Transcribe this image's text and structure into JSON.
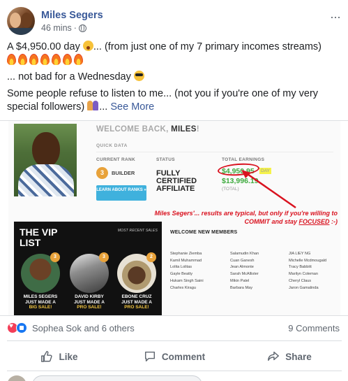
{
  "post": {
    "author": "Miles Segers",
    "time": "46 mins",
    "separator": "·",
    "more_icon": "···",
    "text_line1": "A $4,950.00 day",
    "text_line1_b": "... (from just one of my 7 primary incomes streams)",
    "text_line2": "... not bad for a Wednesday",
    "text_line3": "Some people refuse to listen to me... (not you if you're one of my very special followers)",
    "text_line3_b": "...",
    "see_more": "See More"
  },
  "image": {
    "welcome_prefix": "WELCOME BACK,",
    "welcome_name": "MILES",
    "welcome_suffix": "!",
    "quick_data": "QUICK DATA",
    "current_rank_label": "CURRENT RANK",
    "status_label": "STATUS",
    "total_earnings_label": "TOTAL EARNINGS",
    "rank_number": "3",
    "rank_name": "BUILDER",
    "learn_button": "LEARN ABOUT RANKS »",
    "status_value": "FULLY CERTIFIED AFFILIATE",
    "earnings_today": "$4,950.95",
    "today_tag": "DAY",
    "earnings_secondary": "$13,996.19",
    "earnings_total_label": "(TOTAL)",
    "caption_a": "Miles Segers'... results are typical, but only if you're willing to COMMIT and stay ",
    "caption_focus": "FOCUSED",
    "caption_b": " :-)",
    "vip_title": "THE VIP LIST",
    "recent_sales_label": "MOST RECENT SALES",
    "vip_entries": [
      {
        "rank": "3",
        "name": "MILES SEGERS",
        "line2": "JUST MADE A",
        "line3": "BIG SALE!"
      },
      {
        "rank": "3",
        "name": "DAVID KIRBY",
        "line2": "JUST MADE A",
        "line3": "PRO SALE!"
      },
      {
        "rank": "2",
        "name": "EBONE CRUZ",
        "line2": "JUST MADE A",
        "line3": "PRO SALE!"
      }
    ],
    "new_members_title": "WELCOME NEW MEMBERS",
    "members_col1": [
      "Stephanie Ziemba",
      "Kamil Muhammad",
      "Lolita Lolitas",
      "Gayle Beatty",
      "Hukam Singh Saini",
      "Charles Kiragu"
    ],
    "members_col2": [
      "Salamudin Khan",
      "Cuan Ganesh",
      "Jean Almonte",
      "Sarah McAllister",
      "Mikin Patel",
      "Barbara May"
    ],
    "members_col3": [
      "JIA LIEY NG",
      "Michelle Mcdmougald",
      "Tracy Babbitt",
      "Marilyn Coleman",
      "Cheryl Claus",
      "Jaron Gamalinda"
    ]
  },
  "reactions": {
    "names": "Sophea Sok and 6 others",
    "comments": "9 Comments"
  },
  "actions": {
    "like": "Like",
    "comment": "Comment",
    "share": "Share"
  },
  "colors": {
    "link": "#385898",
    "earnings_green": "#3daa3d",
    "annotation_red": "#d9121f",
    "like_blue": "#1877f2",
    "love_red": "#f33e58"
  }
}
